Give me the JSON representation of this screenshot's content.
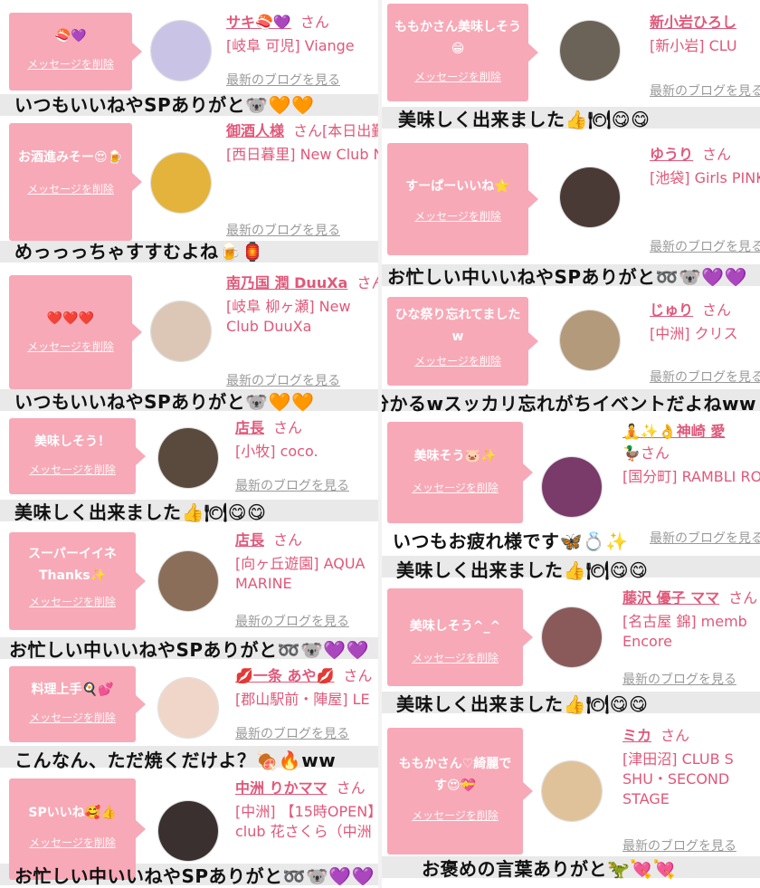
{
  "delete_label": "メッセージを削除",
  "blog_label": "最新のブログを見る",
  "left": [
    {
      "bubble": "🍣💜",
      "name": "サキ🍣💜",
      "san": "さん",
      "loc": "[岐阜 可児] Viange",
      "caption": "いつもいいねやSPありがと🐨🧡🧡",
      "avatar_bg": "#c9c3e6"
    },
    {
      "bubble": "お酒進みそー😍🍺",
      "name": "御酒人様",
      "san": "さん[本日出勤]",
      "loc": "[西日暮里] New Club N",
      "caption": "めっっっちゃすすむよね🍺🏮",
      "avatar_bg": "#e3b33b"
    },
    {
      "bubble": "❤️❤️❤️",
      "name": "南乃国 潤 DuuXa",
      "san": "さん[本日出勤]",
      "loc": "[岐阜 柳ヶ瀬] New Club DuuXa",
      "caption": "いつもいいねやSPありがと🐨🧡🧡",
      "avatar_bg": "#dcc7b6"
    },
    {
      "bubble": "美味しそう！",
      "name": "店長",
      "san": "さん",
      "loc": "[小牧] coco.",
      "caption": "美味しく出来ました👍🍽😋😋",
      "avatar_bg": "#5a4a3e"
    },
    {
      "bubble": "スーパーイイネ Thanks✨",
      "name": "店長",
      "san": "さん",
      "loc": "[向ヶ丘遊園] AQUA MARINE",
      "caption": "お忙しい中いいねやSPありがと➿🐨💜💜",
      "avatar_bg": "#8a6e5a"
    },
    {
      "bubble": "料理上手🍳💕",
      "name": "💋一条 あや💋",
      "san": "さん",
      "loc": "[郡山駅前・陣屋] LE",
      "caption": "こんなん、ただ焼くだけよ？🍖🔥ww",
      "avatar_bg": "#f0d6c8"
    },
    {
      "bubble": "SPいいね🥰👍",
      "name": "中洲 りかママ",
      "san": "さん",
      "loc": "[中洲] 【15時OPEN】club 花さくら（中洲",
      "caption": "お忙しい中いいねやSPありがと➿🐨💜💜",
      "avatar_bg": "#3a3030"
    }
  ],
  "right": [
    {
      "bubble": "ももかさん美味しそう😁",
      "name": "新小岩ひろし",
      "san": "",
      "loc": "[新小岩] CLU",
      "caption": "美味しく出来ました👍🍽😋😋",
      "avatar_bg": "#6b6258"
    },
    {
      "bubble": "すーぱーいいね⭐",
      "name": "ゆうり",
      "san": "さん",
      "loc": "[池袋] Girls PINK",
      "caption": "お忙しい中いいねやSPありがと➿🐨💜💜",
      "avatar_bg": "#4a3a36"
    },
    {
      "bubble": "ひな祭り忘れてましたw",
      "name": "じゅり",
      "san": "さん",
      "loc": "[中洲] クリス",
      "caption": "分かるwスッカリ忘れがちイベントだよねww",
      "avatar_bg": "#b39a7a"
    },
    {
      "bubble": "美味そう🐷✨",
      "name": "🧘✨👌神崎 愛",
      "san": "🦆さん",
      "loc": "[国分町] RAMBLI ROSE",
      "caption": "いつもお疲れ様です🦋💍✨",
      "caption2": "美味しく出来ました👍🍽😋😋",
      "avatar_bg": "#7a3a6a"
    },
    {
      "bubble": "美味しそう^_^",
      "name": "藤沢 優子 ママ",
      "san": "さん",
      "loc": "[名古屋 錦] memb Encore",
      "caption": "美味しく出来ました👍🍽😋😋",
      "avatar_bg": "#8a5a5a"
    },
    {
      "bubble": "ももかさん♡綺麗です😍💝",
      "name": "ミカ",
      "san": "さん",
      "loc": "[津田沼] CLUB S SHU・SECOND STAGE",
      "caption": "お褒めの言葉ありがと🦖💘💘",
      "avatar_bg": "#e0c29a"
    }
  ]
}
